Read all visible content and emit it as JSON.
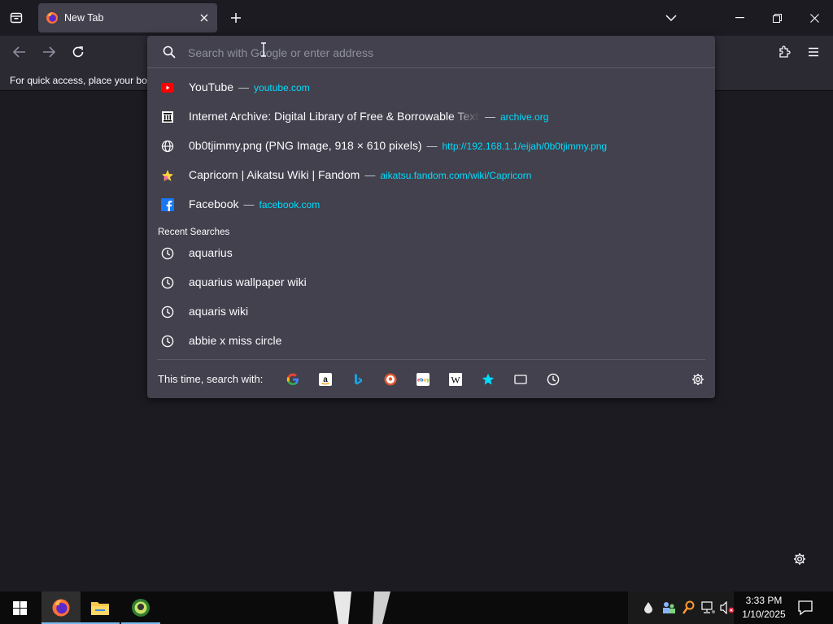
{
  "tab": {
    "title": "New Tab"
  },
  "bookmarks_hint": "For quick access, place your bookmarks here on the bookmarks toolbar.",
  "urlbar": {
    "placeholder": "Search with Google or enter address"
  },
  "suggestions": [
    {
      "title": "YouTube",
      "url": "youtube.com",
      "icon": "youtube-icon"
    },
    {
      "title": "Internet Archive: Digital Library of Free & Borrowable Texts",
      "url": "archive.org",
      "icon": "archive-icon"
    },
    {
      "title": "0b0tjimmy.png (PNG Image, 918 × 610 pixels)",
      "url": "http://192.168.1.1/eijah/0b0tjimmy.png",
      "icon": "globe-icon"
    },
    {
      "title": "Capricorn | Aikatsu Wiki | Fandom",
      "url": "aikatsu.fandom.com/wiki/Capricorn",
      "icon": "fandom-icon"
    },
    {
      "title": "Facebook",
      "url": "facebook.com",
      "icon": "facebook-icon"
    }
  ],
  "separator": "—",
  "recent_searches": {
    "header": "Recent Searches",
    "items": [
      "aquarius",
      "aquarius wallpaper wiki",
      "aquaris wiki",
      "abbie x miss circle"
    ]
  },
  "one_off": {
    "label": "This time, search with:",
    "engines": [
      "google-icon",
      "amazon-icon",
      "bing-icon",
      "duckduckgo-icon",
      "ebay-icon",
      "wikipedia-icon",
      "bookmarks-star-icon",
      "tabs-icon",
      "history-icon"
    ]
  },
  "taskbar": {
    "apps": [
      "firefox-icon",
      "file-explorer-icon",
      "app-icon"
    ],
    "clock": {
      "time": "3:33 PM",
      "date": "1/10/2025"
    }
  },
  "colors": {
    "accent_url": "#00ddff",
    "popup_bg": "#42414d",
    "page_bg": "#1c1b22"
  }
}
